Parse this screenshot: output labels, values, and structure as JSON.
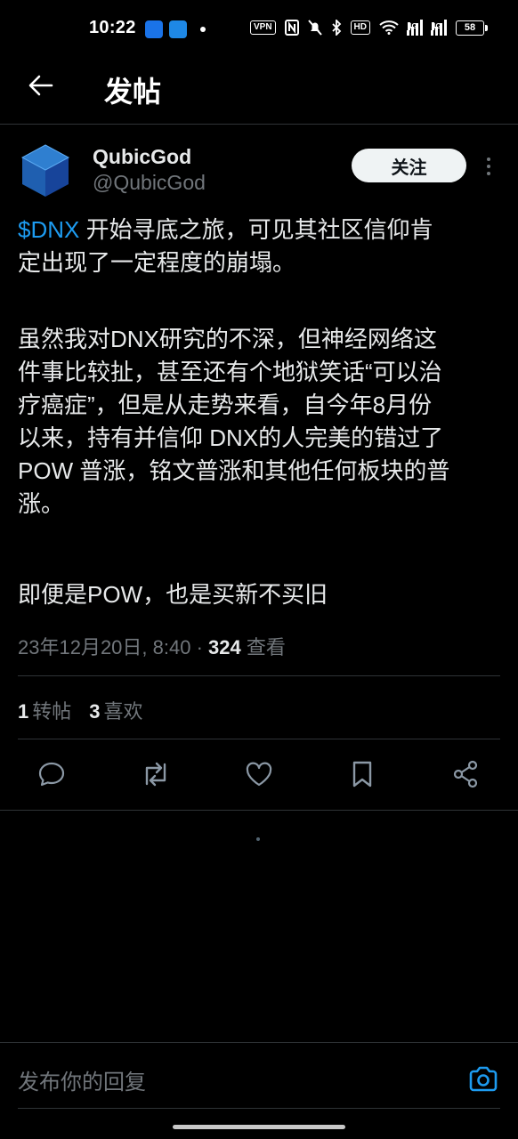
{
  "status_bar": {
    "time": "10:22",
    "vpn_label": "VPN",
    "signal1_label": "4G",
    "signal2_label": "4G",
    "battery": "58"
  },
  "header": {
    "back_icon": "arrow-left-icon",
    "title": "发帖"
  },
  "post": {
    "author": {
      "display_name": "QubicGod",
      "handle": "@QubicGod"
    },
    "follow_label": "关注",
    "text": {
      "p1_cashtag": "$DNX",
      "p1_line1_rest": " 开始寻底之旅，可见其社区信仰肯",
      "p1_line2": "定出现了一定程度的崩塌。",
      "p2_lines": [
        "虽然我对DNX研究的不深，但神经网络这",
        "件事比较扯，甚至还有个地狱笑话“可以治",
        "疗癌症”，但是从走势来看，自今年8月份",
        "以来，持有并信仰 DNX的人完美的错过了",
        "POW 普涨，铭文普涨和其他任何板块的普",
        "涨。"
      ],
      "p3": "即便是POW，也是买新不买旧"
    },
    "timestamp": "23年12月20日, 8:40",
    "separator": " · ",
    "views_count": "324",
    "views_label": " 查看",
    "stats": {
      "reposts_count": "1",
      "reposts_label": "转帖",
      "likes_count": "3",
      "likes_label": "喜欢"
    }
  },
  "actions": [
    "reply-icon",
    "repost-icon",
    "like-icon",
    "bookmark-icon",
    "share-icon"
  ],
  "reply_bar": {
    "placeholder": "发布你的回复",
    "camera_icon": "camera-icon"
  },
  "colors": {
    "background": "#000000",
    "text": "#e7e9ea",
    "muted": "#71767b",
    "accent": "#1d9bf0",
    "divider": "#2f3336"
  }
}
